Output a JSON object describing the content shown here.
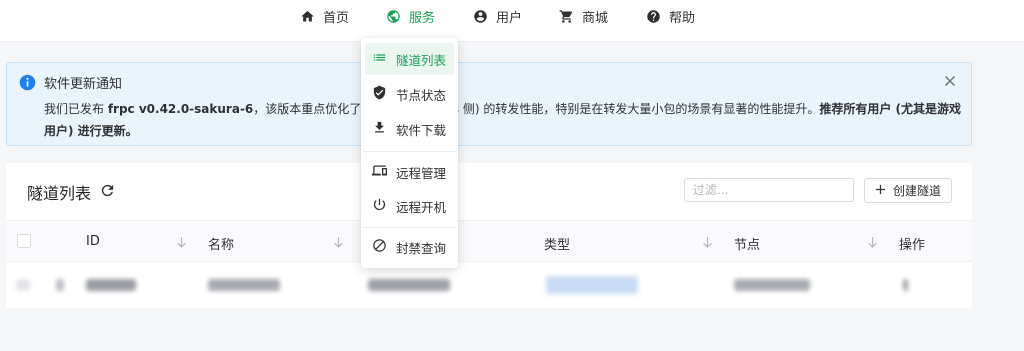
{
  "nav": {
    "items": [
      {
        "label": "首页",
        "icon": "home-icon"
      },
      {
        "label": "服务",
        "icon": "globe-icon",
        "active": true
      },
      {
        "label": "用户",
        "icon": "account-icon"
      },
      {
        "label": "商城",
        "icon": "cart-icon"
      },
      {
        "label": "帮助",
        "icon": "help-icon"
      }
    ]
  },
  "dropdown": {
    "items": [
      {
        "label": "隧道列表",
        "icon": "list-icon",
        "active": true
      },
      {
        "label": "节点状态",
        "icon": "shield-check-icon"
      },
      {
        "label": "软件下载",
        "icon": "download-icon"
      },
      {
        "label": "远程管理",
        "icon": "devices-icon"
      },
      {
        "label": "远程开机",
        "icon": "power-icon"
      },
      {
        "label": "封禁查询",
        "icon": "ban-icon"
      }
    ]
  },
  "notice": {
    "title": "软件更新通知",
    "body": {
      "t1": "我们已发布 ",
      "b1": "frpc v0.42.0-sakura-6",
      "t2": "，该版本重点优化了上行",
      "t3": "(frps 侧) 的转发性能，特别是在转发大量小包的场景有显著的性能提升。",
      "b2": "推荐所有用户 (尤其是游戏用户) 进行更新。"
    }
  },
  "card": {
    "title": "隧道列表",
    "filter_placeholder": "过滤...",
    "create_label": "创建隧道",
    "columns": [
      "ID",
      "名称",
      "类型",
      "节点",
      "操作"
    ]
  },
  "colors": {
    "accent": "#18a058",
    "info": "#2080f0",
    "notice_bg": "#e9f4fd"
  }
}
